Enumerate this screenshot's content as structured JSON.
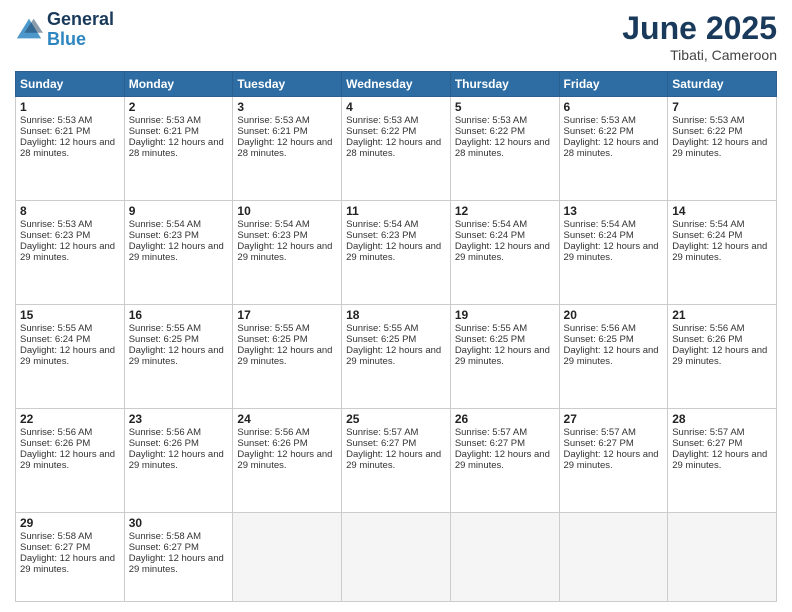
{
  "header": {
    "logo_line1": "General",
    "logo_line2": "Blue",
    "month_title": "June 2025",
    "location": "Tibati, Cameroon"
  },
  "days_of_week": [
    "Sunday",
    "Monday",
    "Tuesday",
    "Wednesday",
    "Thursday",
    "Friday",
    "Saturday"
  ],
  "weeks": [
    [
      {
        "day": "1",
        "sunrise": "Sunrise: 5:53 AM",
        "sunset": "Sunset: 6:21 PM",
        "daylight": "Daylight: 12 hours and 28 minutes."
      },
      {
        "day": "2",
        "sunrise": "Sunrise: 5:53 AM",
        "sunset": "Sunset: 6:21 PM",
        "daylight": "Daylight: 12 hours and 28 minutes."
      },
      {
        "day": "3",
        "sunrise": "Sunrise: 5:53 AM",
        "sunset": "Sunset: 6:21 PM",
        "daylight": "Daylight: 12 hours and 28 minutes."
      },
      {
        "day": "4",
        "sunrise": "Sunrise: 5:53 AM",
        "sunset": "Sunset: 6:22 PM",
        "daylight": "Daylight: 12 hours and 28 minutes."
      },
      {
        "day": "5",
        "sunrise": "Sunrise: 5:53 AM",
        "sunset": "Sunset: 6:22 PM",
        "daylight": "Daylight: 12 hours and 28 minutes."
      },
      {
        "day": "6",
        "sunrise": "Sunrise: 5:53 AM",
        "sunset": "Sunset: 6:22 PM",
        "daylight": "Daylight: 12 hours and 28 minutes."
      },
      {
        "day": "7",
        "sunrise": "Sunrise: 5:53 AM",
        "sunset": "Sunset: 6:22 PM",
        "daylight": "Daylight: 12 hours and 29 minutes."
      }
    ],
    [
      {
        "day": "8",
        "sunrise": "Sunrise: 5:53 AM",
        "sunset": "Sunset: 6:23 PM",
        "daylight": "Daylight: 12 hours and 29 minutes."
      },
      {
        "day": "9",
        "sunrise": "Sunrise: 5:54 AM",
        "sunset": "Sunset: 6:23 PM",
        "daylight": "Daylight: 12 hours and 29 minutes."
      },
      {
        "day": "10",
        "sunrise": "Sunrise: 5:54 AM",
        "sunset": "Sunset: 6:23 PM",
        "daylight": "Daylight: 12 hours and 29 minutes."
      },
      {
        "day": "11",
        "sunrise": "Sunrise: 5:54 AM",
        "sunset": "Sunset: 6:23 PM",
        "daylight": "Daylight: 12 hours and 29 minutes."
      },
      {
        "day": "12",
        "sunrise": "Sunrise: 5:54 AM",
        "sunset": "Sunset: 6:24 PM",
        "daylight": "Daylight: 12 hours and 29 minutes."
      },
      {
        "day": "13",
        "sunrise": "Sunrise: 5:54 AM",
        "sunset": "Sunset: 6:24 PM",
        "daylight": "Daylight: 12 hours and 29 minutes."
      },
      {
        "day": "14",
        "sunrise": "Sunrise: 5:54 AM",
        "sunset": "Sunset: 6:24 PM",
        "daylight": "Daylight: 12 hours and 29 minutes."
      }
    ],
    [
      {
        "day": "15",
        "sunrise": "Sunrise: 5:55 AM",
        "sunset": "Sunset: 6:24 PM",
        "daylight": "Daylight: 12 hours and 29 minutes."
      },
      {
        "day": "16",
        "sunrise": "Sunrise: 5:55 AM",
        "sunset": "Sunset: 6:25 PM",
        "daylight": "Daylight: 12 hours and 29 minutes."
      },
      {
        "day": "17",
        "sunrise": "Sunrise: 5:55 AM",
        "sunset": "Sunset: 6:25 PM",
        "daylight": "Daylight: 12 hours and 29 minutes."
      },
      {
        "day": "18",
        "sunrise": "Sunrise: 5:55 AM",
        "sunset": "Sunset: 6:25 PM",
        "daylight": "Daylight: 12 hours and 29 minutes."
      },
      {
        "day": "19",
        "sunrise": "Sunrise: 5:55 AM",
        "sunset": "Sunset: 6:25 PM",
        "daylight": "Daylight: 12 hours and 29 minutes."
      },
      {
        "day": "20",
        "sunrise": "Sunrise: 5:56 AM",
        "sunset": "Sunset: 6:25 PM",
        "daylight": "Daylight: 12 hours and 29 minutes."
      },
      {
        "day": "21",
        "sunrise": "Sunrise: 5:56 AM",
        "sunset": "Sunset: 6:26 PM",
        "daylight": "Daylight: 12 hours and 29 minutes."
      }
    ],
    [
      {
        "day": "22",
        "sunrise": "Sunrise: 5:56 AM",
        "sunset": "Sunset: 6:26 PM",
        "daylight": "Daylight: 12 hours and 29 minutes."
      },
      {
        "day": "23",
        "sunrise": "Sunrise: 5:56 AM",
        "sunset": "Sunset: 6:26 PM",
        "daylight": "Daylight: 12 hours and 29 minutes."
      },
      {
        "day": "24",
        "sunrise": "Sunrise: 5:56 AM",
        "sunset": "Sunset: 6:26 PM",
        "daylight": "Daylight: 12 hours and 29 minutes."
      },
      {
        "day": "25",
        "sunrise": "Sunrise: 5:57 AM",
        "sunset": "Sunset: 6:27 PM",
        "daylight": "Daylight: 12 hours and 29 minutes."
      },
      {
        "day": "26",
        "sunrise": "Sunrise: 5:57 AM",
        "sunset": "Sunset: 6:27 PM",
        "daylight": "Daylight: 12 hours and 29 minutes."
      },
      {
        "day": "27",
        "sunrise": "Sunrise: 5:57 AM",
        "sunset": "Sunset: 6:27 PM",
        "daylight": "Daylight: 12 hours and 29 minutes."
      },
      {
        "day": "28",
        "sunrise": "Sunrise: 5:57 AM",
        "sunset": "Sunset: 6:27 PM",
        "daylight": "Daylight: 12 hours and 29 minutes."
      }
    ],
    [
      {
        "day": "29",
        "sunrise": "Sunrise: 5:58 AM",
        "sunset": "Sunset: 6:27 PM",
        "daylight": "Daylight: 12 hours and 29 minutes."
      },
      {
        "day": "30",
        "sunrise": "Sunrise: 5:58 AM",
        "sunset": "Sunset: 6:27 PM",
        "daylight": "Daylight: 12 hours and 29 minutes."
      },
      null,
      null,
      null,
      null,
      null
    ]
  ]
}
